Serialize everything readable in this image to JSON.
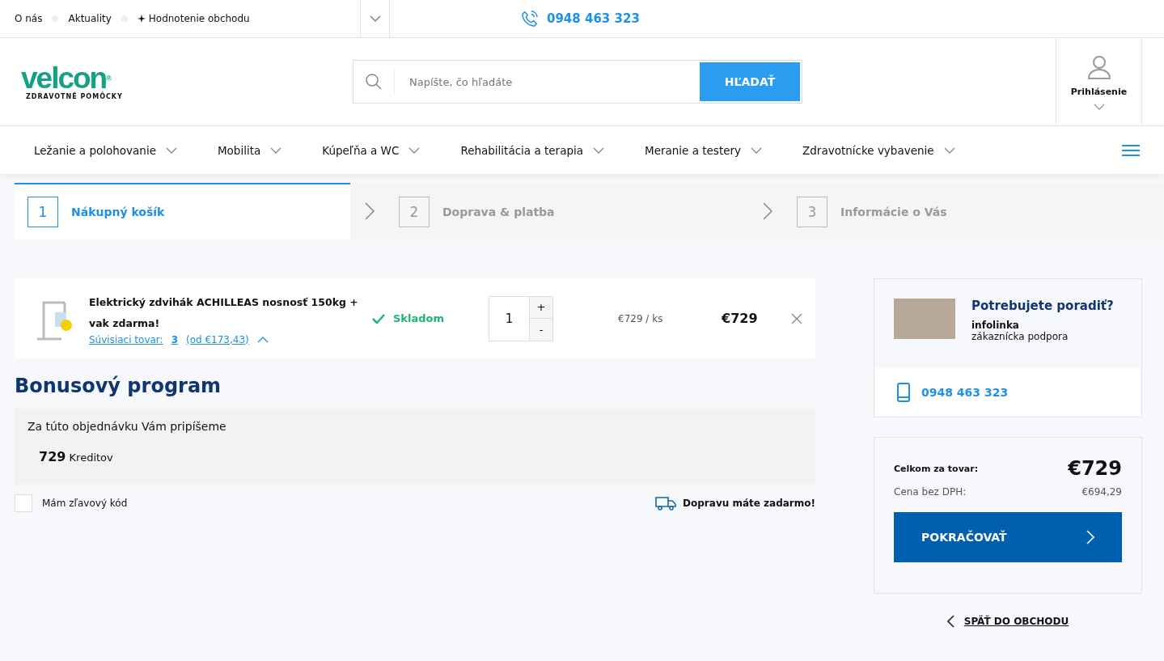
{
  "top_links": [
    {
      "label": "O nás",
      "star": false
    },
    {
      "label": "Aktuality",
      "star": false
    },
    {
      "label": "Hodnotenie obchodu",
      "star": true
    }
  ],
  "top_phone": "0948 463 323",
  "logo": {
    "name": "velcon",
    "mark": "®",
    "tagline": "ZDRAVOTNÉ POMÔCKY"
  },
  "search": {
    "placeholder": "Napíšte, čo hľadáte",
    "button": "HĽADAŤ"
  },
  "login": "Prihlásenie",
  "nav": [
    "Ležanie a polohovanie",
    "Mobilita",
    "Kúpeľňa a WC",
    "Rehabilitácia a terapia",
    "Meranie a testery",
    "Zdravotnícke vybavenie"
  ],
  "steps": [
    {
      "number": "1",
      "label": "Nákupný košík",
      "selected": true
    },
    {
      "number": "2",
      "label": "Doprava & platba",
      "selected": false
    },
    {
      "number": "3",
      "label": "Informácie o Vás",
      "selected": false
    }
  ],
  "cart_item": {
    "name": "Elektrický zdvihák ACHILLEAS nosnosť 150kg + vak zdarma!",
    "related": "Súvisiaci tovar: ",
    "related_count": "3",
    "related_from": " (od €173,43)",
    "stock": "Skladom",
    "qty": "1",
    "plus": "+",
    "minus": "-",
    "unit_price": "€729 / ks",
    "price": "€729"
  },
  "bonus": {
    "title": "Bonusový program",
    "text": "Za túto objednávku Vám pripíšeme",
    "amount": "729",
    "unit": "Kreditov"
  },
  "discount": {
    "label": "Mám zľavový kód",
    "checked": false
  },
  "free_shipping": "Dopravu máte zadarmo!",
  "help": {
    "title": "Potrebujete poradiť?",
    "line1": "infolinka",
    "line2": "zákaznícka podpora",
    "phone": "0948 463 323"
  },
  "summary": {
    "total_label": "Celkom za tovar:",
    "total": "€729",
    "net_label": "Cena bez DPH:",
    "net": "€694,29",
    "continue": "POKRAČOVAŤ",
    "back": "SPÄŤ DO OBCHODU"
  }
}
